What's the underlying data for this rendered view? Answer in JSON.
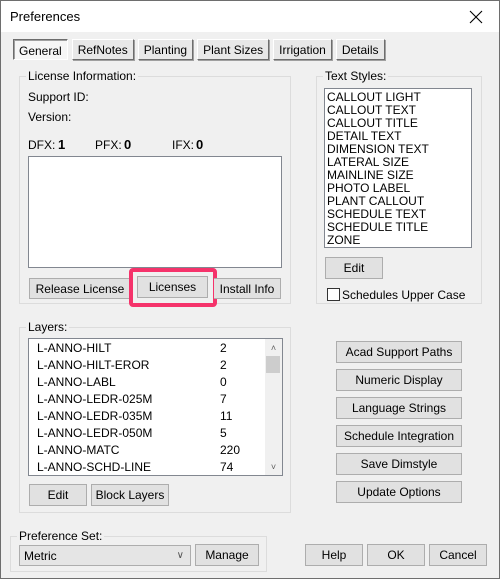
{
  "window": {
    "title": "Preferences",
    "close_icon": "close-icon"
  },
  "tabs": [
    {
      "label": "General",
      "active": true
    },
    {
      "label": "RefNotes",
      "active": false
    },
    {
      "label": "Planting",
      "active": false
    },
    {
      "label": "Plant Sizes",
      "active": false
    },
    {
      "label": "Irrigation",
      "active": false
    },
    {
      "label": "Details",
      "active": false
    }
  ],
  "license": {
    "group_label": "License Information:",
    "support_id_label": "Support ID:",
    "version_label": "Version:",
    "dfx_label": "DFX:",
    "dfx_value": "1",
    "pfx_label": "PFX:",
    "pfx_value": "0",
    "ifx_label": "IFX:",
    "ifx_value": "0",
    "buttons": {
      "release": "Release License",
      "licenses": "Licenses",
      "install_info": "Install Info"
    },
    "highlight_color": "#f5336b"
  },
  "text_styles": {
    "group_label": "Text Styles:",
    "items": [
      "CALLOUT LIGHT",
      "CALLOUT TEXT",
      "CALLOUT TITLE",
      "DETAIL TEXT",
      "DIMENSION TEXT",
      "LATERAL SIZE",
      "MAINLINE SIZE",
      "PHOTO LABEL",
      "PLANT CALLOUT",
      "SCHEDULE TEXT",
      "SCHEDULE TITLE",
      "ZONE"
    ],
    "edit_label": "Edit",
    "upper_case_label": "Schedules Upper Case",
    "upper_case_checked": false
  },
  "layers": {
    "group_label": "Layers:",
    "rows": [
      {
        "name": "L-ANNO-HILT",
        "count": "2"
      },
      {
        "name": "L-ANNO-HILT-EROR",
        "count": "2"
      },
      {
        "name": "L-ANNO-LABL",
        "count": "0"
      },
      {
        "name": "L-ANNO-LEDR-025M",
        "count": "7"
      },
      {
        "name": "L-ANNO-LEDR-035M",
        "count": "11"
      },
      {
        "name": "L-ANNO-LEDR-050M",
        "count": "5"
      },
      {
        "name": "L-ANNO-MATC",
        "count": "220"
      },
      {
        "name": "L-ANNO-SCHD-LINE",
        "count": "74"
      }
    ],
    "edit_label": "Edit",
    "block_layers_label": "Block Layers"
  },
  "side_buttons": [
    "Acad Support Paths",
    "Numeric Display",
    "Language Strings",
    "Schedule Integration",
    "Save Dimstyle",
    "Update Options"
  ],
  "preference_set": {
    "group_label": "Preference Set:",
    "selected": "Metric",
    "manage_label": "Manage"
  },
  "footer": {
    "help": "Help",
    "ok": "OK",
    "cancel": "Cancel"
  }
}
